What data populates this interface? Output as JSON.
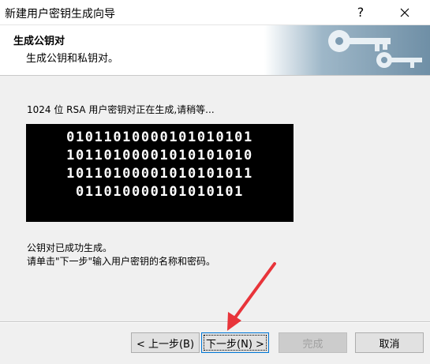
{
  "window": {
    "title": "新建用户密钥生成向导",
    "help_label": "?",
    "close_label": "✕"
  },
  "header": {
    "title": "生成公钥对",
    "subtitle": "生成公钥和私钥对。",
    "art_icon": "keys-icon"
  },
  "content": {
    "status_text": "1024 位 RSA 用户密钥对正在生成,请稍等...",
    "binary_lines": [
      "01011010000101010101",
      "10110100001010101010",
      "10110100001010101011",
      "011010000101010101"
    ],
    "done_line1": "公钥对已成功生成。",
    "done_line2": "请单击\"下一步\"输入用户密钥的名称和密码。"
  },
  "buttons": {
    "back": "< 上一步(B)",
    "next": "下一步(N) >",
    "finish": "完成",
    "cancel": "取消"
  },
  "colors": {
    "accent": "#0078d7",
    "annotation_arrow": "#e8343a"
  }
}
